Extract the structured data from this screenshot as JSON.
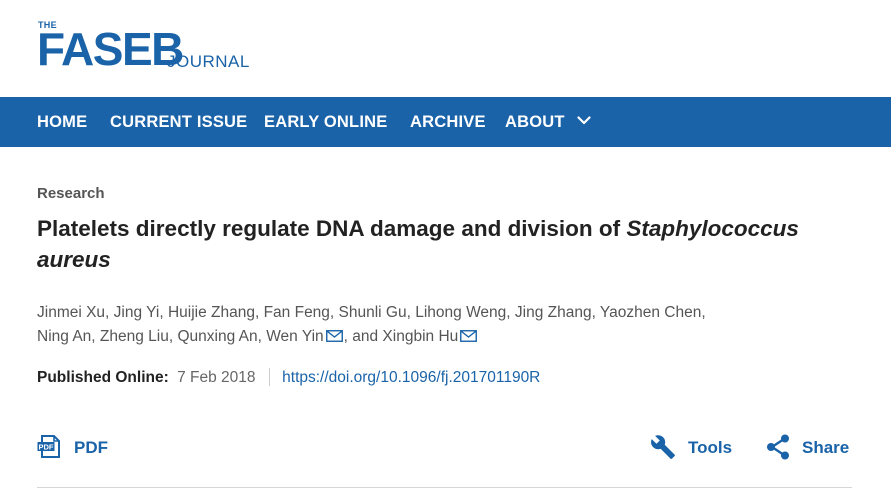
{
  "logo": {
    "the": "THE",
    "name": "FASEB",
    "journal": "JOURNAL"
  },
  "nav": {
    "home": "HOME",
    "current_issue": "CURRENT ISSUE",
    "early_online": "EARLY ONLINE",
    "archive": "ARCHIVE",
    "about": "ABOUT"
  },
  "article": {
    "type": "Research",
    "title_plain": "Platelets directly regulate DNA damage and division of ",
    "title_italic": "Staphylococcus aureus",
    "authors_line1": "Jinmei Xu, Jing Yi, Huijie Zhang, Fan Feng, Shunli Gu, Lihong Weng, Jing Zhang, Yaozhen Chen,",
    "authors_line2_a": "Ning An, Zheng Liu, Qunxing An, Wen Yin",
    "authors_line2_b": ", and Xingbin Hu",
    "published_label": "Published Online:",
    "published_date": "7 Feb 2018",
    "doi": "https://doi.org/10.1096/fj.201701190R"
  },
  "actions": {
    "pdf": "PDF",
    "tools": "Tools",
    "share": "Share"
  },
  "colors": {
    "brand_blue": "#1a63a8",
    "text_dark": "#222222",
    "text_muted": "#555555"
  },
  "icons": [
    "chevron-down-icon",
    "mail-icon",
    "pdf-icon",
    "wrench-icon",
    "share-icon"
  ]
}
